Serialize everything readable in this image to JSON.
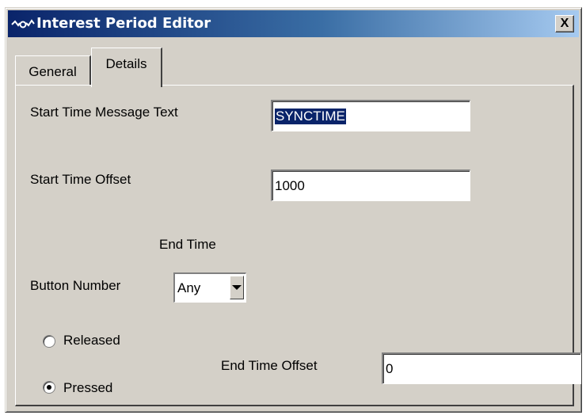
{
  "window": {
    "title": "Interest Period Editor",
    "close_glyph": "X"
  },
  "tabs": [
    {
      "label": "General",
      "active": false
    },
    {
      "label": "Details",
      "active": true
    }
  ],
  "details": {
    "start_time_message_text": {
      "label": "Start Time Message Text",
      "value": "SYNCTIME",
      "selected": true
    },
    "start_time_offset": {
      "label": "Start Time Offset",
      "value": "1000"
    },
    "end_time_heading": "End Time",
    "button_number": {
      "label": "Button Number",
      "value": "Any"
    },
    "radios": [
      {
        "label": "Released",
        "checked": false
      },
      {
        "label": "Pressed",
        "checked": true
      }
    ],
    "end_time_offset": {
      "label": "End Time Offset",
      "value": "0"
    }
  },
  "icons": {
    "app": "waveform-icon",
    "close": "close-icon",
    "dropdown": "chevron-down-icon"
  },
  "colors": {
    "title_start": "#0a246a",
    "title_end": "#a6caf0",
    "face": "#d4d0c8",
    "selection": "#0a246a"
  }
}
